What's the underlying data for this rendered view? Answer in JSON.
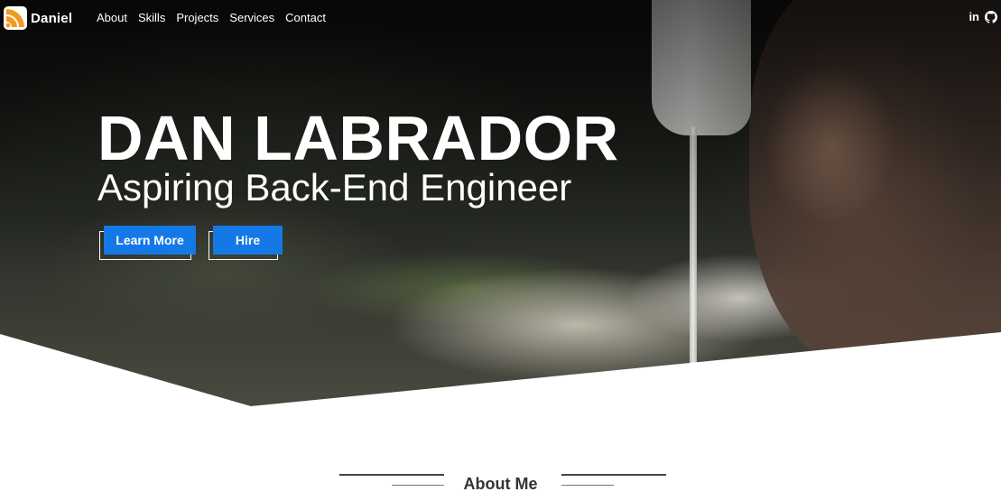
{
  "nav": {
    "logo_text": "Daniel",
    "links": [
      "About",
      "Skills",
      "Projects",
      "Services",
      "Contact"
    ],
    "social": {
      "linkedin_label": "in"
    }
  },
  "hero": {
    "title": "DAN LABRADOR",
    "subtitle": "Aspiring Back-End Engineer",
    "primary_button": "Learn More",
    "secondary_button": "Hire"
  },
  "about": {
    "heading": "About Me"
  },
  "colors": {
    "accent": "#1479e6",
    "logo_orange": "#f39a1e",
    "text_dark": "#333333"
  },
  "icons": {
    "logo": "rss-style-logo-icon",
    "linkedin": "linkedin-icon",
    "github": "github-icon"
  }
}
